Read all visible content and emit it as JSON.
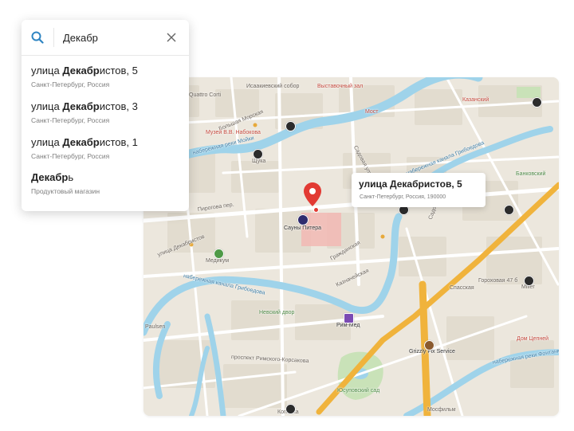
{
  "search": {
    "query": "Декабр",
    "placeholder": ""
  },
  "results": [
    {
      "pre": "улица ",
      "match": "Декабр",
      "post": "истов, 5",
      "subtitle": "Санкт-Петербург, Россия"
    },
    {
      "pre": "улица ",
      "match": "Декабр",
      "post": "истов, 3",
      "subtitle": "Санкт-Петербург, Россия"
    },
    {
      "pre": "улица ",
      "match": "Декабр",
      "post": "истов, 1",
      "subtitle": "Санкт-Петербург, Россия"
    },
    {
      "pre": "",
      "match": "Декабр",
      "post": "ь",
      "subtitle": "Продуктовый магазин"
    }
  ],
  "callout": {
    "title": "улица Декабристов, 5",
    "subtitle": "Санкт-Петербург, Россия, 190000"
  },
  "map_labels": {
    "quattro": "Quattro Corti",
    "isaac": "Исаакиевский собор",
    "exhibition": "Выставочный зал",
    "kazansky": "Казанский",
    "bolshaya_morskaya": "Большая Морская",
    "most": "Мост",
    "nabokov": "Музей В.В. Набокова",
    "moika": "набережная реки Мойки",
    "shchuka": "Щука",
    "griboedova_top": "набережная канала Грибоедова",
    "bankovsky": "Банковский",
    "pirogova": "Пирогова пер.",
    "saunas": "Сауны Питера",
    "dekabristov_street": "улица Декабристов",
    "medikum": "Медикум",
    "kaznacheyskaya": "Казначейская",
    "grazhdanskaya": "Гражданская",
    "sadovaya": "Садовая улица",
    "griboedova_bottom": "набережная канала Грибоедова",
    "sadovaya2": "Садовая улица",
    "gorokhovaya": "Гороховая 47 б",
    "spasskaya": "Спасская",
    "miller": "Miller",
    "nevsky": "Невский двор",
    "rim_med": "Рим-Мед",
    "paulsen": "Paulsen",
    "grizzly": "Grizzly Fix Service",
    "dom_tsepney": "Дом Цепней",
    "rimsky": "проспект Римского-Корсакова",
    "yusupov": "Юсуповский сад",
    "fontanka": "набережная реки Фонтанки",
    "kopeyka": "Копейка",
    "mosfilm": "Мосфильм"
  },
  "icons": {
    "search": "search-icon",
    "close": "close-icon",
    "pin": "location-pin-icon"
  },
  "colors": {
    "accent": "#2f85c2",
    "pin": "#e23a33",
    "water": "#9fd3ea",
    "highway": "#f0b33c",
    "park": "#c9e2b8"
  }
}
